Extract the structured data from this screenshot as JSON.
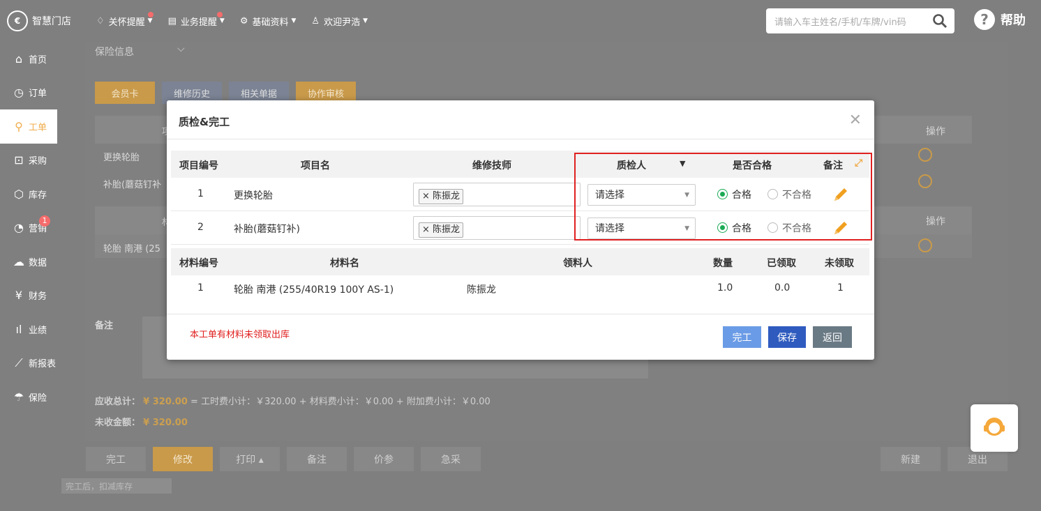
{
  "header": {
    "logo_text": "智慧门店",
    "logo_mark": "€",
    "nav": [
      {
        "label": "关怀提醒",
        "icon": "bell-icon",
        "badge": true
      },
      {
        "label": "业务提醒",
        "icon": "clipboard-icon",
        "badge": true
      },
      {
        "label": "基础资料",
        "icon": "gear-icon",
        "badge": false
      },
      {
        "label": "欢迎尹浩",
        "icon": "user-icon",
        "badge": false
      }
    ],
    "search_placeholder": "请输入车主姓名/手机/车牌/vin码",
    "help_label": "帮助"
  },
  "sidebar": {
    "items": [
      {
        "label": "首页",
        "icon": "home-icon"
      },
      {
        "label": "订单",
        "icon": "clock-icon"
      },
      {
        "label": "工单",
        "icon": "wrench-icon",
        "active": true
      },
      {
        "label": "采购",
        "icon": "cart-icon"
      },
      {
        "label": "库存",
        "icon": "box-icon"
      },
      {
        "label": "营销",
        "icon": "chart-icon",
        "badge": "1"
      },
      {
        "label": "数据",
        "icon": "cloud-icon"
      },
      {
        "label": "财务",
        "icon": "yen-icon"
      },
      {
        "label": "业绩",
        "icon": "bar-chart-icon"
      },
      {
        "label": "新报表",
        "icon": "line-chart-icon"
      },
      {
        "label": "保险",
        "icon": "umbrella-icon"
      }
    ]
  },
  "background": {
    "section_title": "保险信息",
    "tabs": [
      "会员卡",
      "维修历史",
      "相关单据",
      "协作审核"
    ],
    "rows": [
      "更换轮胎",
      "补胎(蘑菇钉补",
      "轮胎 南港 (25"
    ],
    "col_head_partial": [
      "项",
      "材"
    ],
    "op_header": "操作",
    "remark_label": "备注",
    "total_label": "应收总计：",
    "total_value": "¥ 320.00",
    "total_detail": "= 工时费小计：￥320.00 + 材料费小计：￥0.00 + 附加费小计：￥0.00",
    "unpaid_label": "未收金额：",
    "unpaid_value": "¥ 320.00",
    "bottom_buttons": [
      "完工",
      "修改",
      "打印 ▴",
      "备注",
      "价参",
      "急采"
    ],
    "right_buttons": [
      "新建",
      "退出"
    ],
    "tooltip": "完工后，扣减库存"
  },
  "modal": {
    "title": "质检&完工",
    "project_headers": [
      "项目编号",
      "项目名",
      "维修技师",
      "质检人",
      "是否合格",
      "备注"
    ],
    "projects": [
      {
        "no": "1",
        "name": "更换轮胎",
        "tech": "陈振龙",
        "inspector": "请选择",
        "pass": "合格",
        "fail": "不合格"
      },
      {
        "no": "2",
        "name": "补胎(蘑菇钉补)",
        "tech": "陈振龙",
        "inspector": "请选择",
        "pass": "合格",
        "fail": "不合格"
      }
    ],
    "material_headers": [
      "材料编号",
      "材料名",
      "领料人",
      "数量",
      "已领取",
      "未领取"
    ],
    "materials": [
      {
        "no": "1",
        "name": "轮胎 南港 (255/40R19 100Y AS-1)",
        "receiver": "陈振龙",
        "qty": "1.0",
        "taken": "0.0",
        "untaken": "1"
      }
    ],
    "warning": "本工单有材料未领取出库",
    "buttons": {
      "finish": "完工",
      "save": "保存",
      "back": "返回"
    }
  },
  "colors": {
    "accent": "#f0ad4e",
    "primary": "#2f5bbf",
    "danger": "#e02020",
    "success": "#1aaa55"
  }
}
